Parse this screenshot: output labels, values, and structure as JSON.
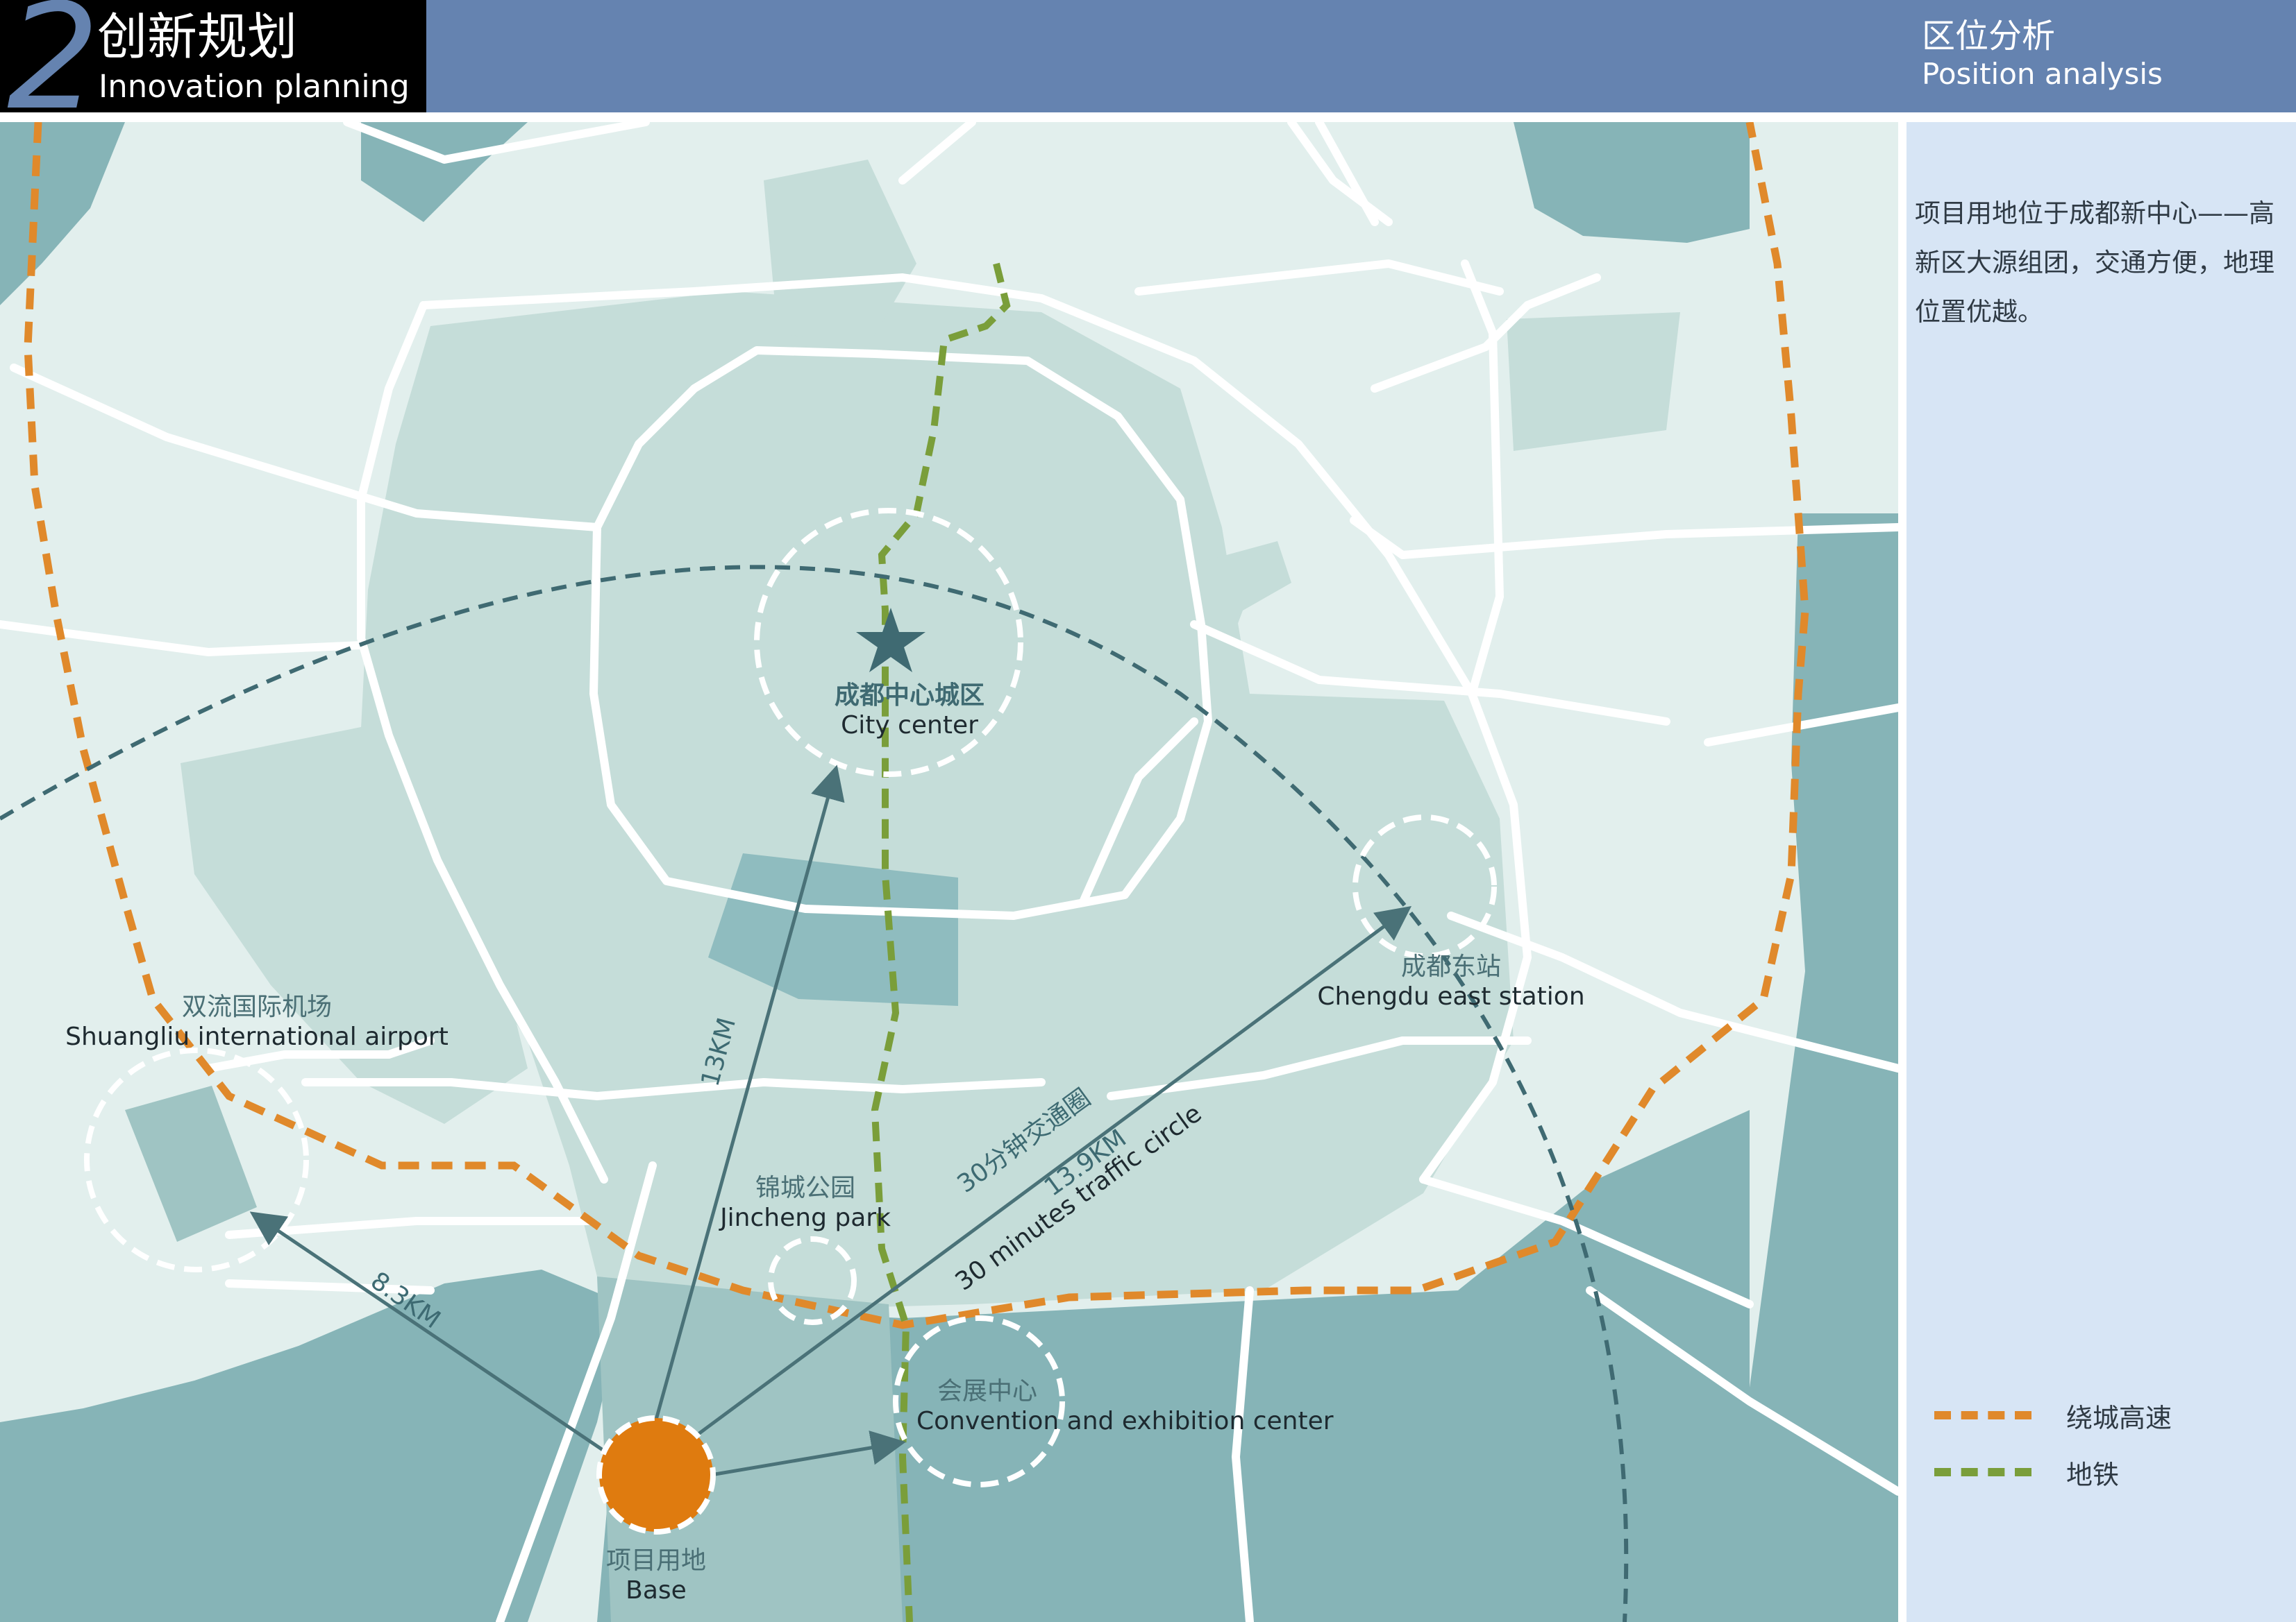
{
  "header": {
    "chapter_number": "2",
    "chapter_title_cn": "创新规划",
    "chapter_title_en": "Innovation planning",
    "section_title_cn": "区位分析",
    "section_title_en": "Position analysis"
  },
  "description": "项目用地位于成都新中心——高新区大源组团，交通方便，地理位置优越。",
  "legend": [
    {
      "label": "绕城高速",
      "color": "#e0892b"
    },
    {
      "label": "地铁",
      "color": "#7a9e3a"
    }
  ],
  "map": {
    "places": {
      "city_center": {
        "cn": "成都中心城区",
        "en": "City center"
      },
      "east_station": {
        "cn": "成都东站",
        "en": "Chengdu east station"
      },
      "airport": {
        "cn": "双流国际机场",
        "en": "Shuangliu international airport"
      },
      "park": {
        "cn": "锦城公园",
        "en": "Jincheng park"
      },
      "convention": {
        "cn": "会展中心",
        "en": "Convention and exhibition center"
      },
      "base": {
        "cn": "项目用地",
        "en": "Base"
      }
    },
    "distances": {
      "to_city_center": "13KM",
      "to_airport": "8.3KM",
      "to_east_station": "13.9KM"
    },
    "traffic_circle": {
      "cn": "30分钟交通圈",
      "en": "30 minutes traffic circle"
    },
    "colors": {
      "background": "#e2efed",
      "urban_area": "#c5ddd9",
      "water_dark": "#86b4b7",
      "road": "#ffffff",
      "ring_highway": "#e0892b",
      "metro": "#7a9e3a",
      "base": "#df7b0f",
      "arrow": "#4a7278"
    }
  }
}
